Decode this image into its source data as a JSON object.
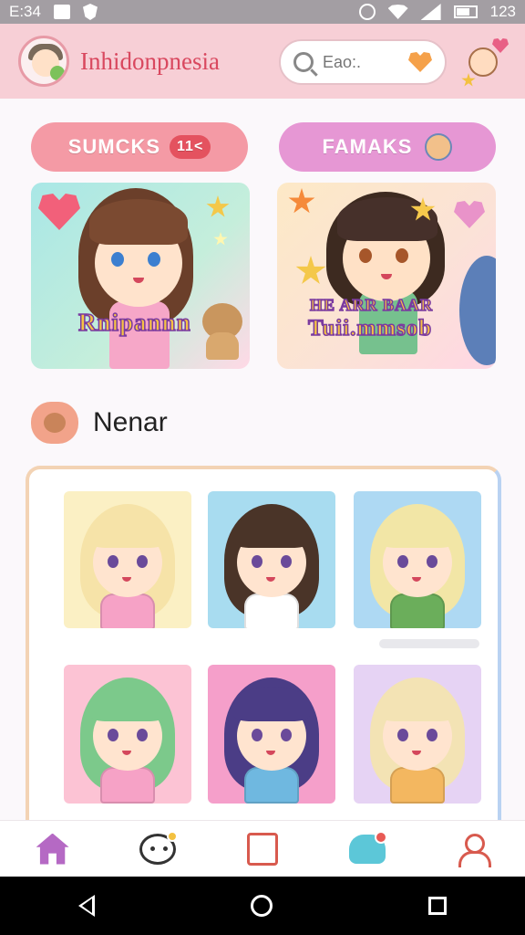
{
  "status_bar": {
    "time": "E:34",
    "right_text": "123"
  },
  "header": {
    "app_title": "Inhidonpnesia",
    "search_placeholder": "Eao:."
  },
  "tabs": [
    {
      "label": "SUMCKS",
      "badge": "11<",
      "accent": "#f49aa5"
    },
    {
      "label": "FAMAKS",
      "accent": "#e697d4"
    }
  ],
  "featured": [
    {
      "banner": "Rnipannn"
    },
    {
      "banner_line1": "HE ARR BAAR",
      "banner_line2": "Tuii.mmsob"
    }
  ],
  "section": {
    "title": "Nenar"
  },
  "characters": [
    {
      "bg": "#fbf0c4",
      "hair": "#f6e3a8",
      "accent": "#f6a2c6"
    },
    {
      "bg": "#a8dcf0",
      "hair": "#4a3428",
      "accent": "#ffffff"
    },
    {
      "bg": "#aed9f3",
      "hair": "#f2e6a6",
      "accent": "#6bae5b"
    },
    {
      "bg": "#fcc3d4",
      "hair": "#7cc98b",
      "accent": "#f6a2c6"
    },
    {
      "bg": "#f59fca",
      "hair": "#4b3d86",
      "accent": "#6fb8e0"
    },
    {
      "bg": "#e6d3f4",
      "hair": "#f3e3b4",
      "accent": "#f3b760"
    }
  ],
  "bottom_nav": [
    {
      "name": "home",
      "color": "#b569c4"
    },
    {
      "name": "chat",
      "color": "#333333"
    },
    {
      "name": "calendar",
      "color": "#d85a4e"
    },
    {
      "name": "creature",
      "color": "#5cc7d8"
    },
    {
      "name": "profile",
      "color": "#d85a4e"
    }
  ]
}
